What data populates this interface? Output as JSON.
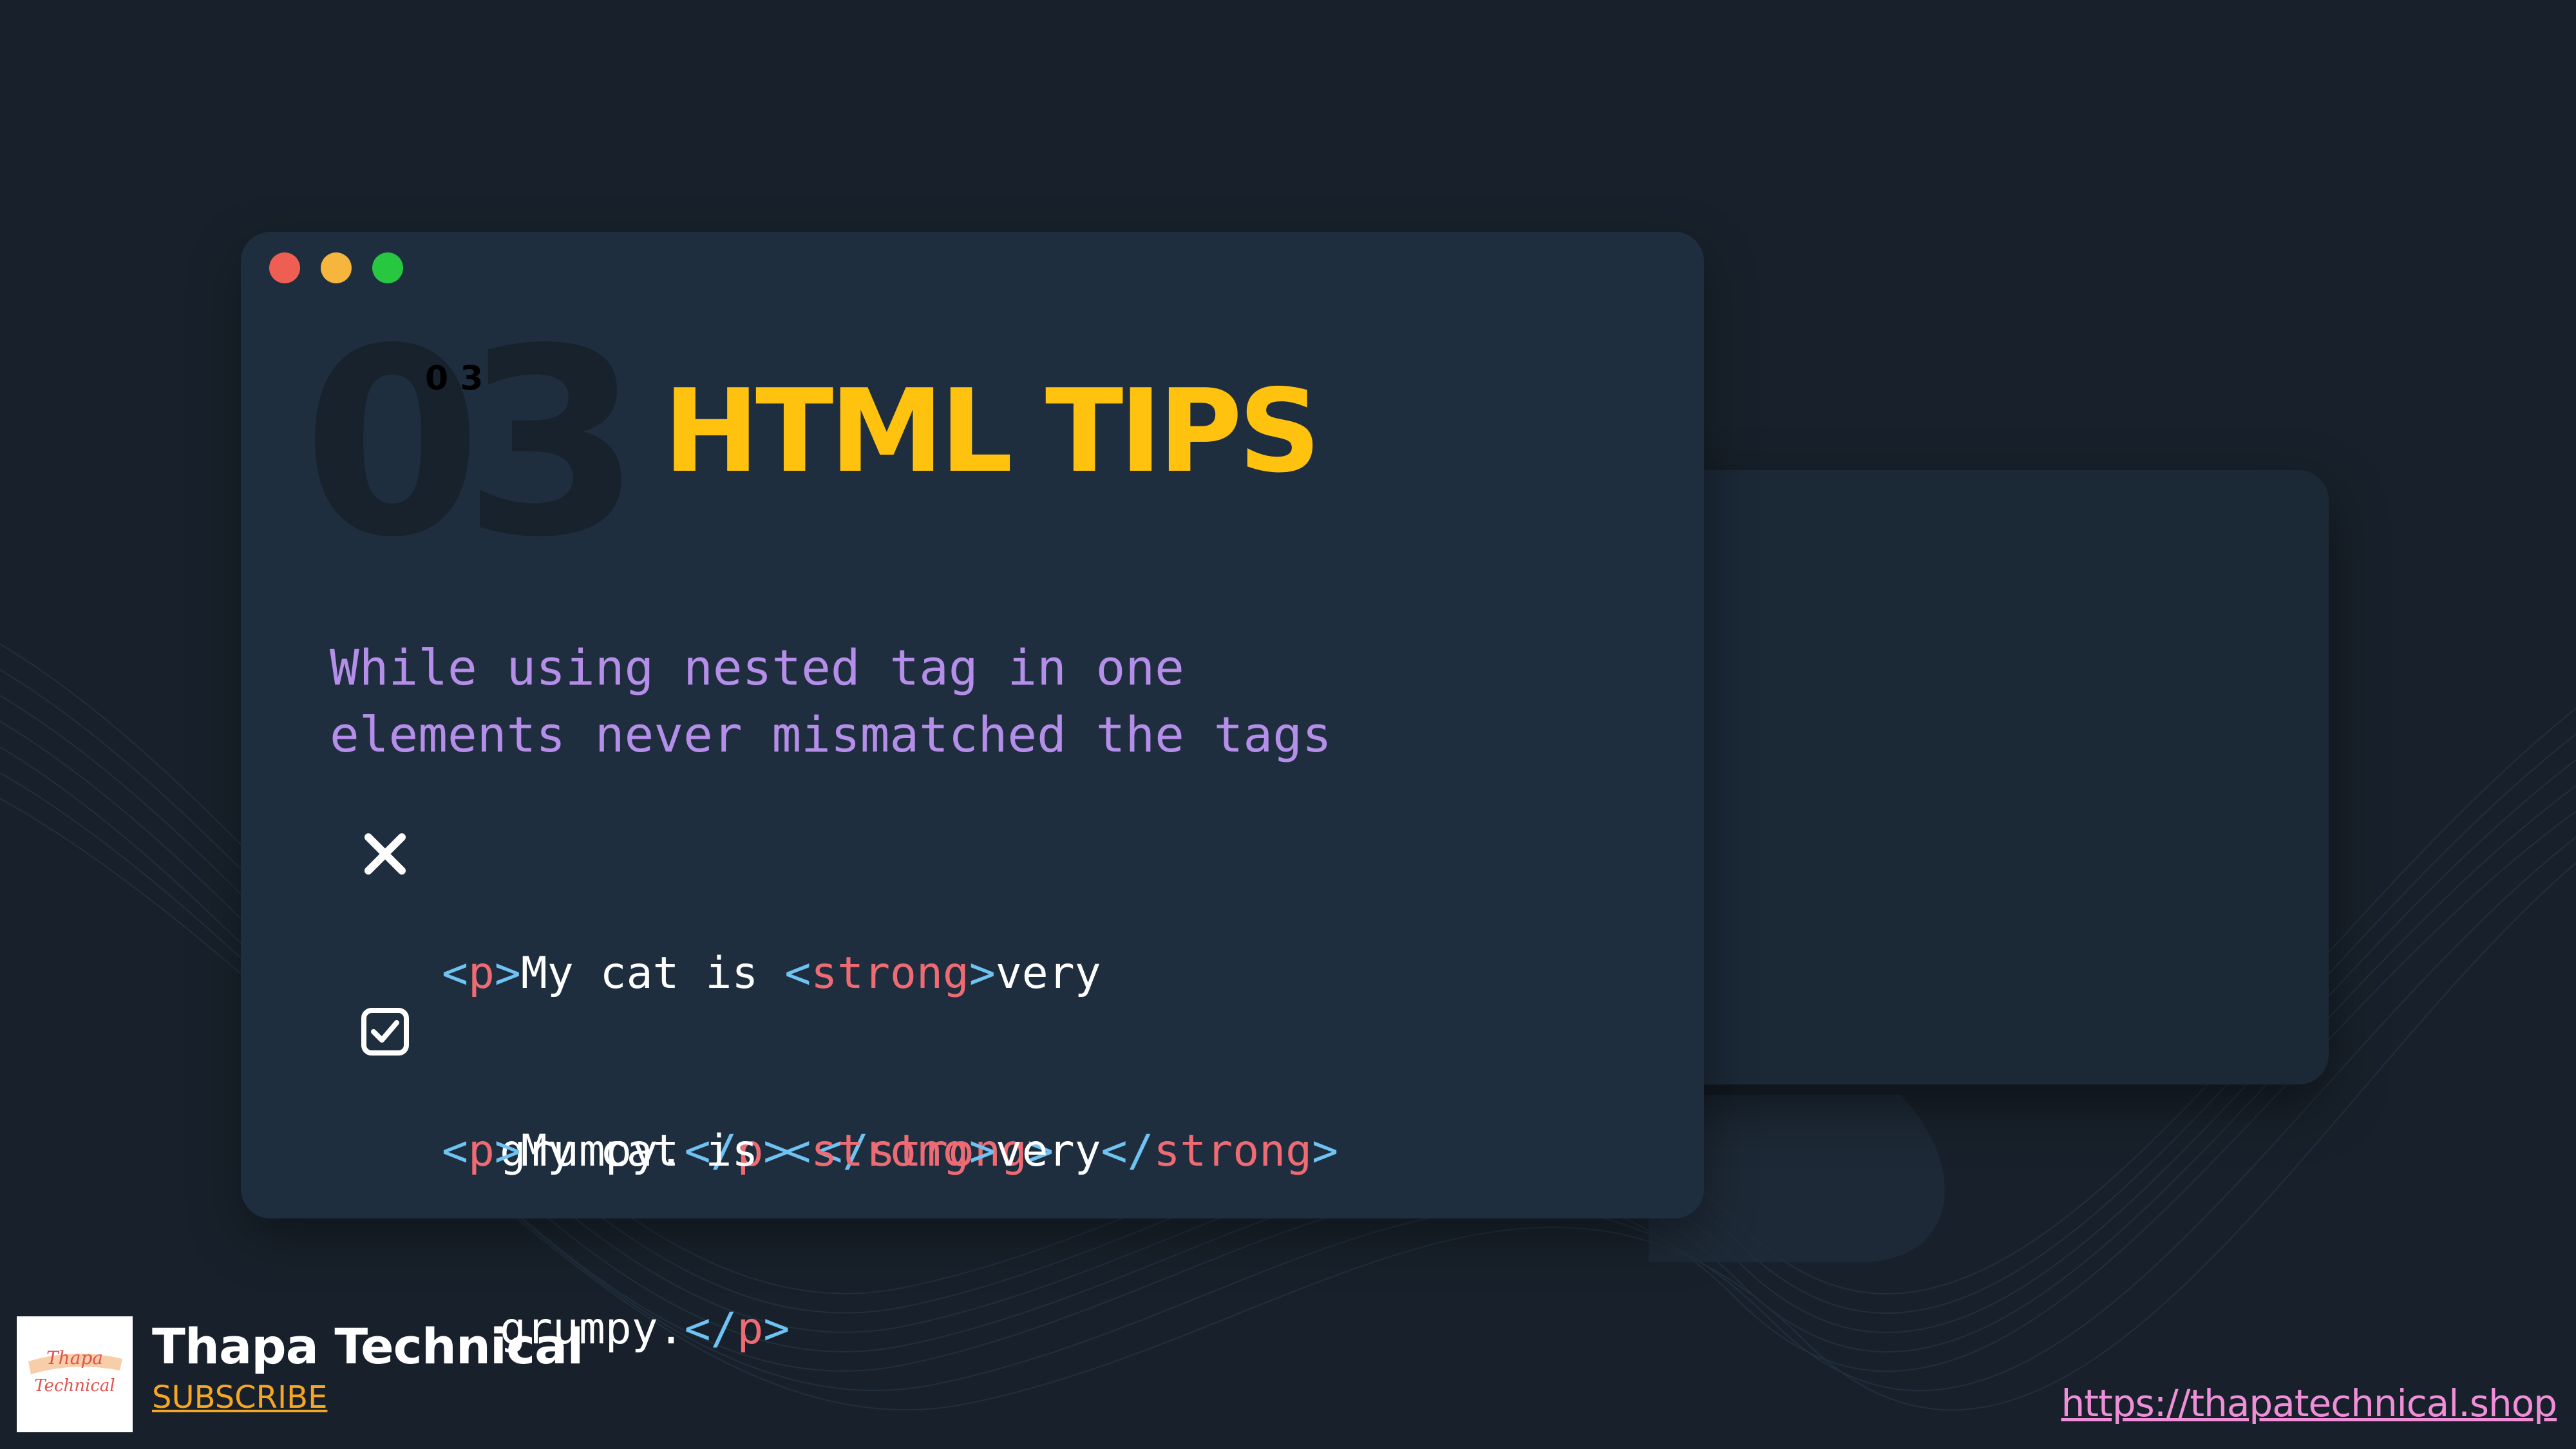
{
  "slide": {
    "number": "03",
    "number_small": "0 3",
    "title": "HTML TIPS",
    "description_line1": "While using nested tag in one",
    "description_line2": "elements never mismatched the tags"
  },
  "window_dots": {
    "red": "#ee5e53",
    "yellow": "#f6b53c",
    "green": "#27c840"
  },
  "examples": [
    {
      "status": "incorrect",
      "icon": "cross-icon",
      "line1": {
        "o1": "<",
        "t1": "p",
        "c1": ">",
        "text1": "My cat is ",
        "o2": "<",
        "t2": "strong",
        "c2": ">",
        "text2": "very"
      },
      "line2": {
        "text1": "grumpy.",
        "o1": "</",
        "t1": "p",
        "c1": ">",
        "space": " ",
        "o2": "</",
        "t2": "strong",
        "c2": ">"
      }
    },
    {
      "status": "correct",
      "icon": "checkbox-checked-icon",
      "line1": {
        "o1": "<",
        "t1": "p",
        "c1": ">",
        "text1": "My cat is ",
        "o2": "<",
        "t2": "strong",
        "c2": ">",
        "text2": "very",
        "o3": "</",
        "t3": "strong",
        "c3": ">"
      },
      "line2": {
        "text1": "grumpy.",
        "o1": "</",
        "t1": "p",
        "c1": ">"
      }
    }
  ],
  "footer": {
    "logo_text_1": "Thapa",
    "logo_text_2": "Technical",
    "channel": "Thapa Technical",
    "subscribe": "SUBSCRIBE",
    "website": "https://thapatechnical.shop"
  },
  "colors": {
    "background": "#18212b",
    "window_main": "#1f2e3f",
    "window_secondary": "#1b2836",
    "title": "#ffc20e",
    "description": "#b48ee8",
    "tag": "#ef6b73",
    "bracket": "#6ec3f2",
    "subscribe": "#f5a623",
    "website": "#f08fd8"
  }
}
